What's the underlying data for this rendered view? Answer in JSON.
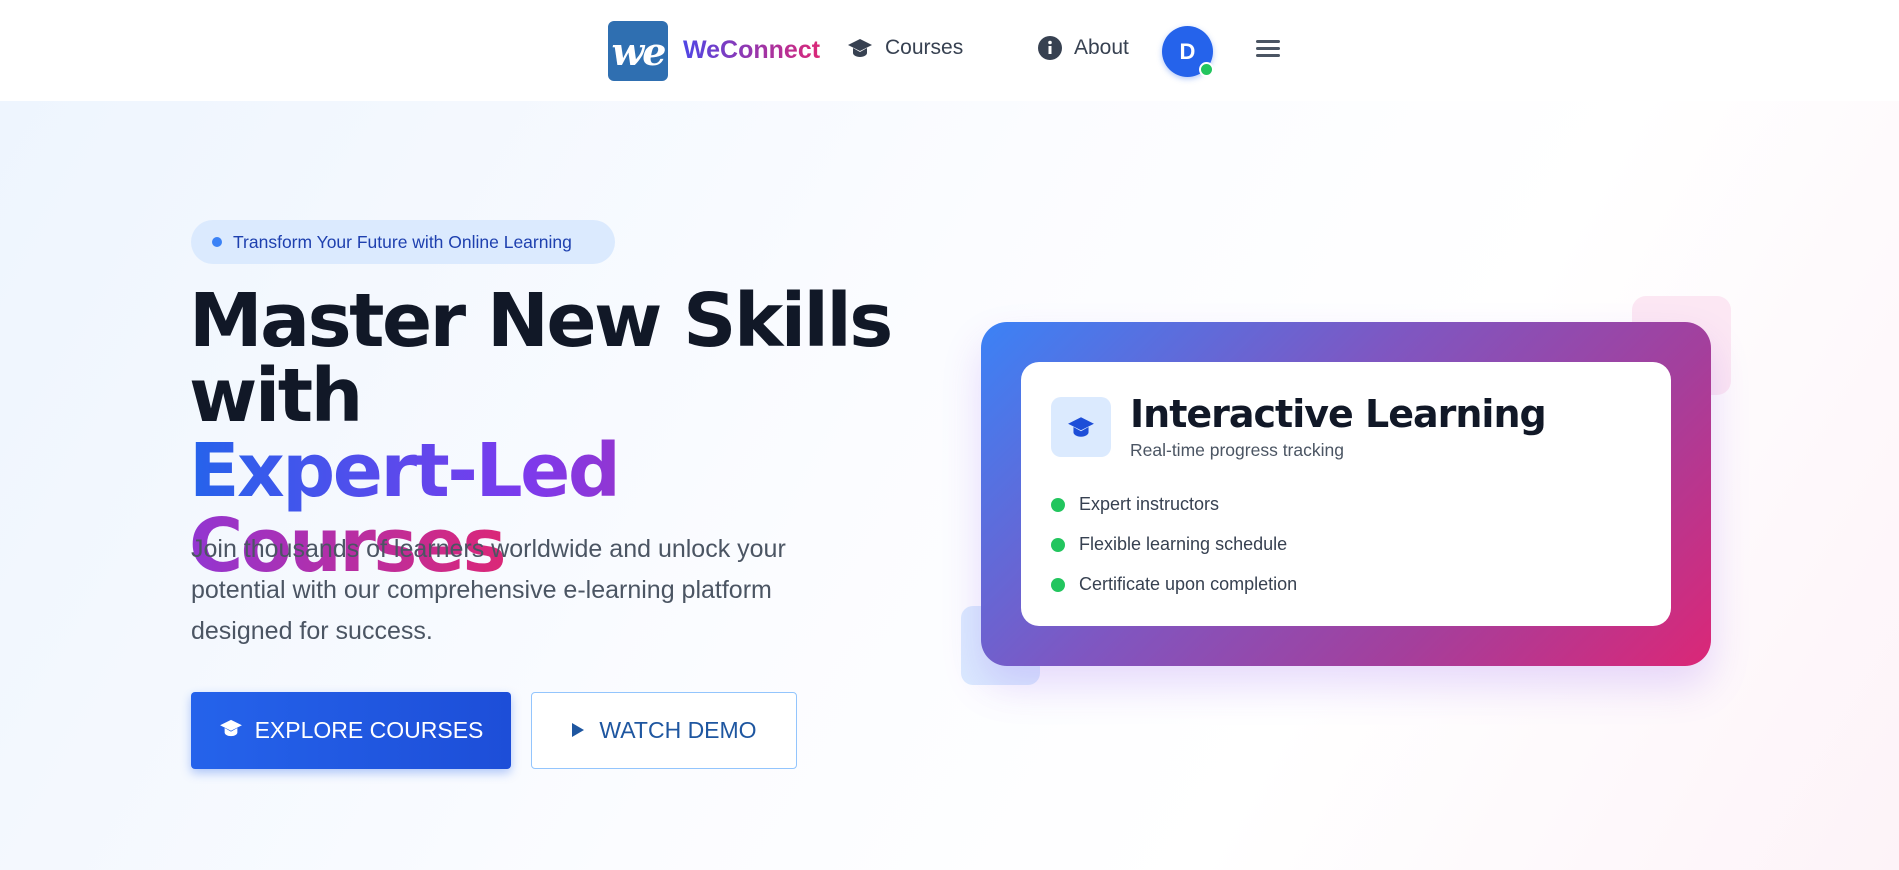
{
  "nav": {
    "logo_text": "we",
    "brand": "WeConnect",
    "links": [
      {
        "label": "Courses",
        "icon": "graduation-cap-icon"
      },
      {
        "label": "About",
        "icon": "info-icon"
      }
    ],
    "avatar_initial": "D",
    "menu_icon": "hamburger-menu-icon"
  },
  "hero": {
    "badge": "Transform Your Future with Online Learning",
    "headline_line1": "Master New Skills",
    "headline_line2": "with",
    "headline_gradient": "Expert-Led Courses",
    "subtext": "Join thousands of learners worldwide and unlock your potential with our comprehensive e-learning platform designed for success.",
    "primary_button": "EXPLORE COURSES",
    "secondary_button": "WATCH DEMO"
  },
  "card": {
    "title": "Interactive Learning",
    "subtitle": "Real-time progress tracking",
    "features": [
      "Expert instructors",
      "Flexible learning schedule",
      "Certificate upon completion"
    ]
  },
  "colors": {
    "primary": "#2563eb",
    "accent_pink": "#db2777",
    "accent_purple": "#7c3aed",
    "success": "#22c55e"
  }
}
